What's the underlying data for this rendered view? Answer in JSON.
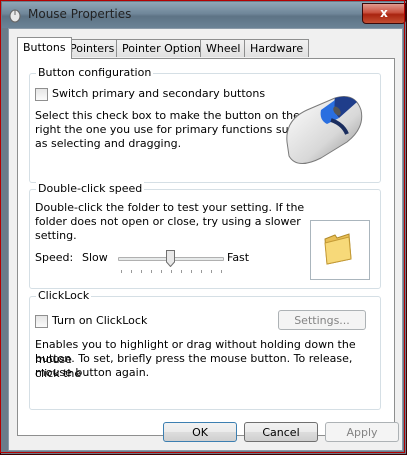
{
  "window": {
    "title": "Mouse Properties",
    "close_glyph": "x"
  },
  "tabs": [
    {
      "label": "Buttons",
      "active": true
    },
    {
      "label": "Pointers",
      "active": false
    },
    {
      "label": "Pointer Options",
      "active": false
    },
    {
      "label": "Wheel",
      "active": false
    },
    {
      "label": "Hardware",
      "active": false
    }
  ],
  "button_configuration": {
    "title": "Button configuration",
    "checkbox_label": "Switch primary and secondary buttons",
    "checked": false,
    "description_lines": [
      "Select this check box to make the button on the",
      "right the one you use for primary functions such",
      "as selecting and dragging."
    ]
  },
  "double_click": {
    "title": "Double-click speed",
    "description_lines": [
      "Double-click the folder to test your setting. If the",
      "folder does not open or close, try using a slower",
      "setting."
    ],
    "speed_label": "Speed:",
    "slow_label": "Slow",
    "fast_label": "Fast",
    "slider_value": 0.5
  },
  "clicklock": {
    "title": "ClickLock",
    "checkbox_label": "Turn on ClickLock",
    "checked": false,
    "settings_button": "Settings...",
    "description_lines": [
      "Enables you to highlight or drag without holding down the mouse",
      "button. To set, briefly press the mouse button. To release, click the",
      "mouse button again."
    ]
  },
  "footer": {
    "ok": "OK",
    "cancel": "Cancel",
    "apply": "Apply"
  },
  "colors": {
    "accent_blue": "#1e6fd0",
    "folder_yellow": "#f2c94c"
  }
}
